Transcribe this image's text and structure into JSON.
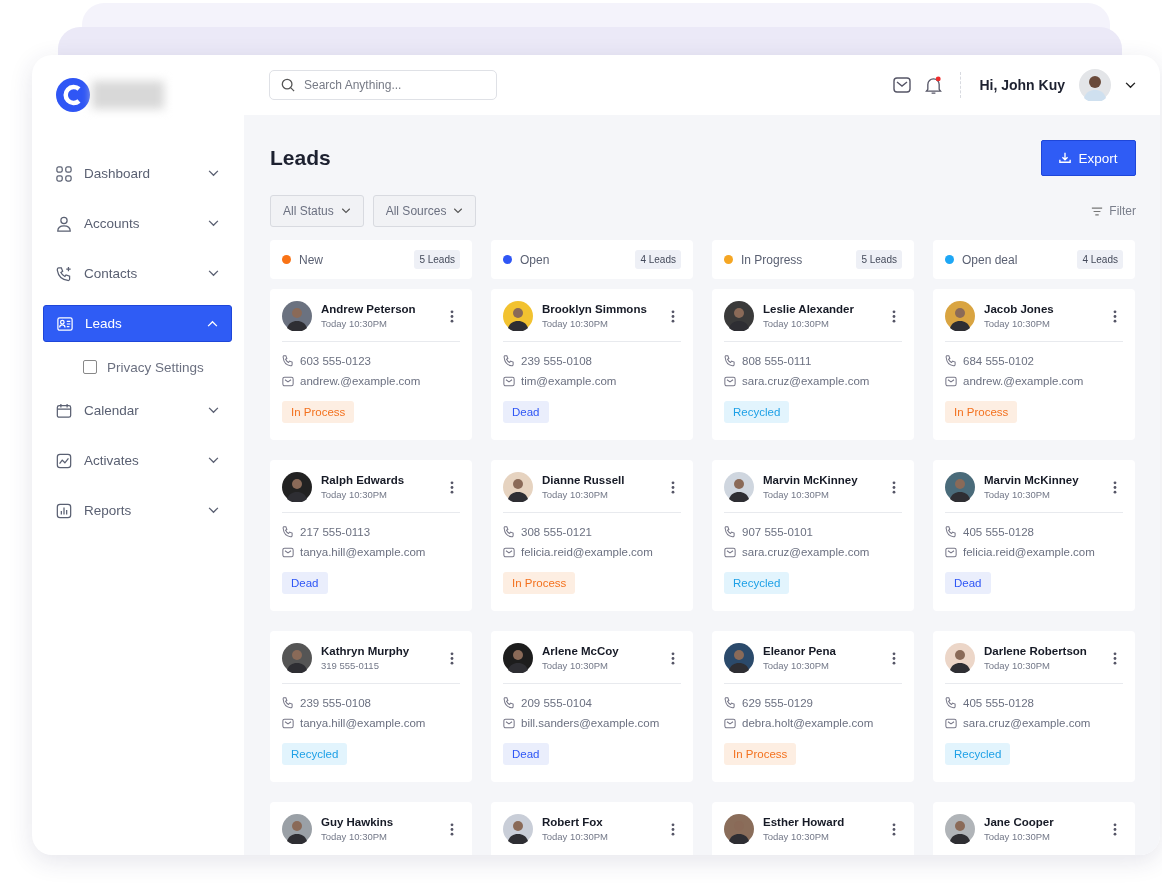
{
  "sidebar": {
    "items": [
      {
        "label": "Dashboard",
        "selected": false,
        "expanded": false
      },
      {
        "label": "Accounts",
        "selected": false,
        "expanded": false
      },
      {
        "label": "Contacts",
        "selected": false,
        "expanded": false
      },
      {
        "label": "Leads",
        "selected": true,
        "expanded": true,
        "children": [
          {
            "label": "Privacy Settings",
            "checked": false
          }
        ]
      },
      {
        "label": "Calendar",
        "selected": false,
        "expanded": false
      },
      {
        "label": "Activates",
        "selected": false,
        "expanded": false
      },
      {
        "label": "Reports",
        "selected": false,
        "expanded": false
      }
    ]
  },
  "header": {
    "search": {
      "placeholder": "Search Anything..."
    },
    "notifications": {
      "unread": true
    },
    "greeting": "Hi, John Kuy"
  },
  "page": {
    "title": "Leads",
    "export_button": "Export",
    "filters": [
      "All Status",
      "All Sources"
    ],
    "filter_button": "Filter"
  },
  "columns": [
    {
      "title": "New",
      "color": "#f97316",
      "count": "5 Leads",
      "cards": [
        {
          "name": "Andrew Peterson",
          "time": "Today 10:30PM",
          "phone": "603 555-0123",
          "email": "andrew.@example.com",
          "status": "In Process",
          "kind": "process"
        },
        {
          "name": "Ralph Edwards",
          "time": "Today 10:30PM",
          "phone": "217 555-0113",
          "email": "tanya.hill@example.com",
          "status": "Dead",
          "kind": "dead"
        },
        {
          "name": "Kathryn Murphy",
          "time": "319 555-0115",
          "phone": "239 555-0108",
          "email": "tanya.hill@example.com",
          "status": "Recycled",
          "kind": "recycled"
        },
        {
          "name": "Guy Hawkins",
          "time": "Today 10:30PM"
        }
      ]
    },
    {
      "title": "Open",
      "color": "#2f56f5",
      "count": "4 Leads",
      "cards": [
        {
          "name": "Brooklyn Simmons",
          "time": "Today 10:30PM",
          "phone": "239 555-0108",
          "email": "tim@example.com",
          "status": "Dead",
          "kind": "dead"
        },
        {
          "name": "Dianne Russell",
          "time": "Today 10:30PM",
          "phone": "308 555-0121",
          "email": "felicia.reid@example.com",
          "status": "In Process",
          "kind": "process"
        },
        {
          "name": "Arlene McCoy",
          "time": "Today 10:30PM",
          "phone": "209 555-0104",
          "email": "bill.sanders@example.com",
          "status": "Dead",
          "kind": "dead"
        },
        {
          "name": "Robert Fox",
          "time": "Today 10:30PM"
        }
      ]
    },
    {
      "title": "In Progress",
      "color": "#f5a623",
      "count": "5 Leads",
      "cards": [
        {
          "name": "Leslie Alexander",
          "time": "Today 10:30PM",
          "phone": "808 555-0111",
          "email": "sara.cruz@example.com",
          "status": "Recycled",
          "kind": "recycled"
        },
        {
          "name": "Marvin McKinney",
          "time": "Today 10:30PM",
          "phone": "907 555-0101",
          "email": "sara.cruz@example.com",
          "status": "Recycled",
          "kind": "recycled"
        },
        {
          "name": "Eleanor Pena",
          "time": "Today 10:30PM",
          "phone": "629 555-0129",
          "email": "debra.holt@example.com",
          "status": "In Process",
          "kind": "process"
        },
        {
          "name": "Esther Howard",
          "time": "Today 10:30PM"
        }
      ]
    },
    {
      "title": "Open deal",
      "color": "#1ea7f5",
      "count": "4 Leads",
      "cards": [
        {
          "name": "Jacob Jones",
          "time": "Today 10:30PM",
          "phone": "684 555-0102",
          "email": "andrew.@example.com",
          "status": "In Process",
          "kind": "process"
        },
        {
          "name": "Marvin McKinney",
          "time": "Today 10:30PM",
          "phone": "405 555-0128",
          "email": "felicia.reid@example.com",
          "status": "Dead",
          "kind": "dead"
        },
        {
          "name": "Darlene Robertson",
          "time": "Today 10:30PM",
          "phone": "405 555-0128",
          "email": "sara.cruz@example.com",
          "status": "Recycled",
          "kind": "recycled"
        },
        {
          "name": "Jane Cooper",
          "time": "Today 10:30PM"
        }
      ]
    }
  ]
}
